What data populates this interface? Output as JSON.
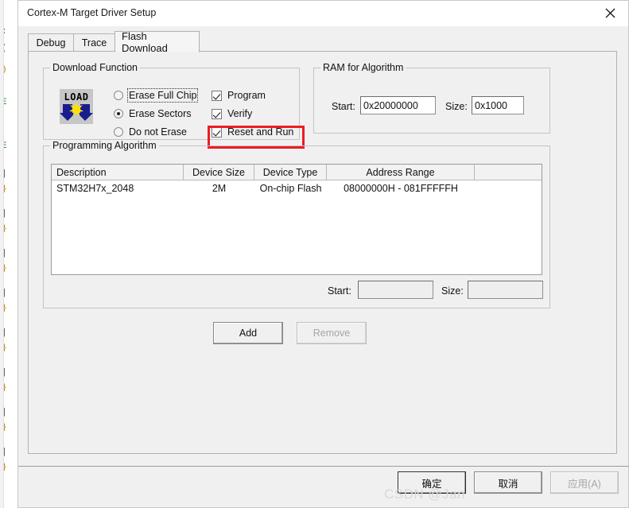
{
  "window": {
    "title": "Cortex-M Target Driver Setup",
    "close_icon": "close-icon"
  },
  "tabs": [
    {
      "label": "Debug",
      "active": false
    },
    {
      "label": "Trace",
      "active": false
    },
    {
      "label": "Flash Download",
      "active": true
    }
  ],
  "download_function": {
    "title": "Download Function",
    "icon": "load-icon",
    "radios": [
      {
        "label": "Erase Full Chip",
        "checked": false,
        "focused": true
      },
      {
        "label": "Erase Sectors",
        "checked": true,
        "focused": false
      },
      {
        "label": "Do not Erase",
        "checked": false,
        "focused": false
      }
    ],
    "checkboxes": [
      {
        "label": "Program",
        "checked": true,
        "highlighted": false
      },
      {
        "label": "Verify",
        "checked": true,
        "highlighted": false
      },
      {
        "label": "Reset and Run",
        "checked": true,
        "highlighted": true
      }
    ],
    "highlight_color": "#ec1c24"
  },
  "ram_for_algorithm": {
    "title": "RAM for Algorithm",
    "start_label": "Start:",
    "start_value": "0x20000000",
    "size_label": "Size:",
    "size_value": "0x1000"
  },
  "programming_algorithm": {
    "title": "Programming Algorithm",
    "columns": [
      "Description",
      "Device Size",
      "Device Type",
      "Address Range",
      ""
    ],
    "rows": [
      {
        "description": "STM32H7x_2048",
        "device_size": "2M",
        "device_type": "On-chip Flash",
        "address_range": "08000000H - 081FFFFFH"
      }
    ],
    "start_label": "Start:",
    "start_value": "",
    "size_label": "Size:",
    "size_value": "",
    "add_button": "Add",
    "remove_button": "Remove"
  },
  "footer": {
    "ok_button": "确定",
    "cancel_button": "取消",
    "apply_button": "应用(A)"
  },
  "watermark": "CSDN @Jan",
  "background_code": [
    ";",
    "(",
    ")",
    "E",
    "E",
    "|",
    "}",
    "|",
    "}",
    "|",
    "}",
    "|",
    "}",
    "|",
    "}",
    "|",
    "}",
    "|",
    "}",
    "|",
    "}"
  ]
}
